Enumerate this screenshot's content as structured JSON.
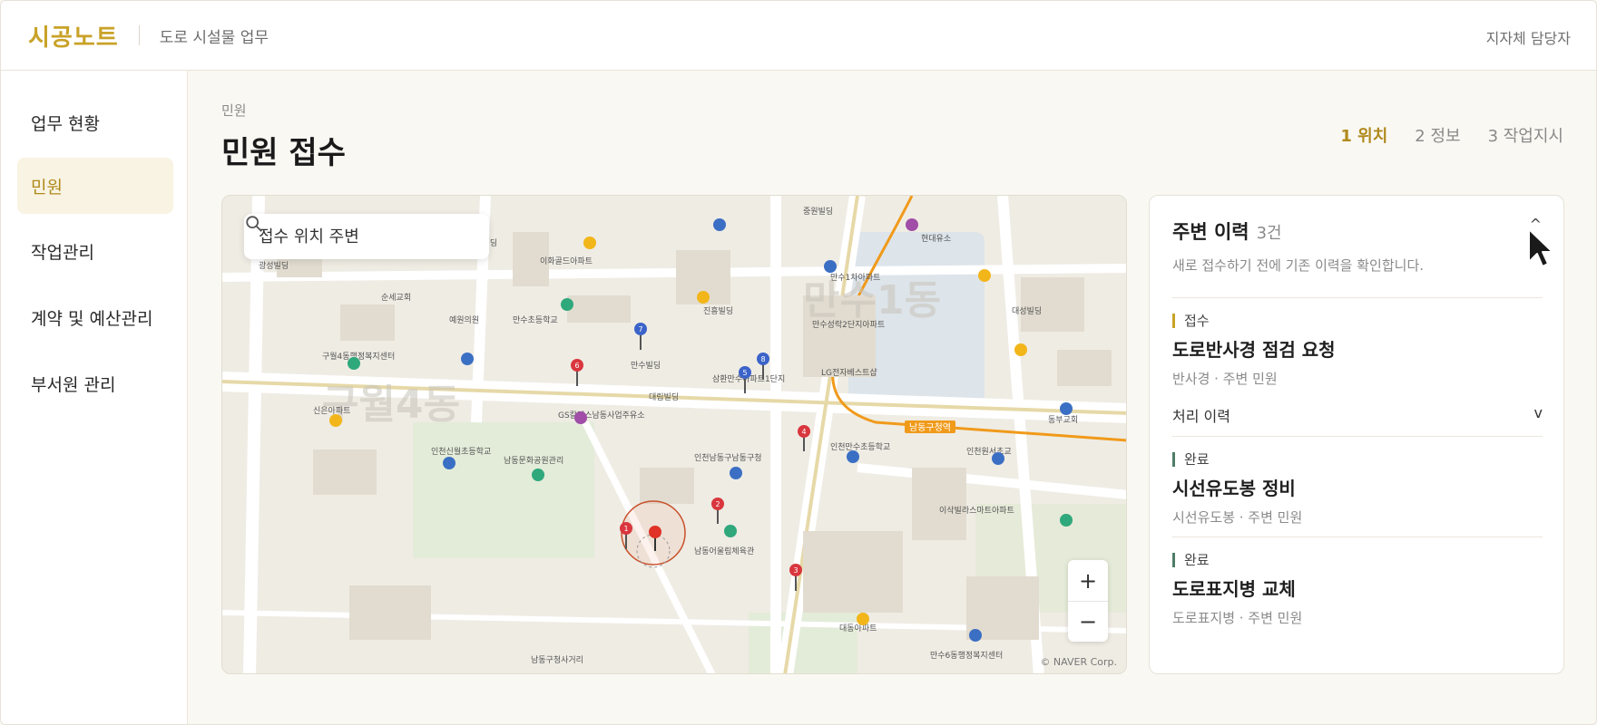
{
  "header": {
    "logo": "시공노트",
    "subtitle": "도로 시설물 업무",
    "user": "지자체 담당자"
  },
  "sidebar": {
    "items": [
      {
        "label": "업무 현황"
      },
      {
        "label": "민원"
      },
      {
        "label": "작업관리"
      },
      {
        "label": "계약 및 예산관리"
      },
      {
        "label": "부서원 관리"
      }
    ],
    "active_index": 1
  },
  "page": {
    "breadcrumb": "민원",
    "title": "민원 접수"
  },
  "steps": [
    {
      "label": "1 위치",
      "active": true
    },
    {
      "label": "2 정보",
      "active": false
    },
    {
      "label": "3 작업지시",
      "active": false
    }
  ],
  "map": {
    "search_placeholder": "접수 위치 주변",
    "dong_labels": [
      "구월4동",
      "만수1동"
    ],
    "station": "남동구청역",
    "copyright": "© NAVER Corp.",
    "zoom_in": "+",
    "zoom_out": "−",
    "markers": [
      "1",
      "2",
      "3",
      "4",
      "5",
      "6",
      "7",
      "8"
    ],
    "place_labels": [
      "광성빌딩",
      "순세교회",
      "예원의원",
      "만수초등학교",
      "이화골드아파트",
      "흥덕빌딩",
      "현대유소",
      "중원빌딩",
      "만수1차아파트",
      "대성빌딩",
      "만수성락2단지아파트",
      "진흥빌딩",
      "만수빌딩",
      "삼환만수아파트1단지",
      "LG전자베스트샵",
      "구월4동행정복지센터",
      "신은아파트",
      "GS칼텍스남동사업주유소",
      "대림빌딩",
      "인천신월초등학교",
      "남동문화공원관리",
      "인천만수초등학교",
      "인천남동구남동구청",
      "남동어울림체육관",
      "이삭빌라스마트아파트",
      "인천원서초교",
      "동부교회",
      "대동아파트",
      "만수6동행정복지센터",
      "남동구청사거리"
    ]
  },
  "panel": {
    "title": "주변 이력",
    "count": "3건",
    "collapse_icon": "^",
    "description": "새로 접수하기 전에 기존 이력을 확인합니다.",
    "history_label": "처리 이력",
    "history_toggle": "v",
    "items": [
      {
        "status": "접수",
        "title": "도로반사경 점검 요청",
        "sub": "반사경 · 주변 민원"
      },
      {
        "status": "완료",
        "title": "시선유도봉 정비",
        "sub": "시선유도봉 · 주변 민원"
      },
      {
        "status": "완료",
        "title": "도로표지병 교체",
        "sub": "도로표지병 · 주변 민원"
      }
    ]
  },
  "colors": {
    "accent": "#c9a227",
    "done": "#4f7d67",
    "metro": "#f09a1a"
  }
}
